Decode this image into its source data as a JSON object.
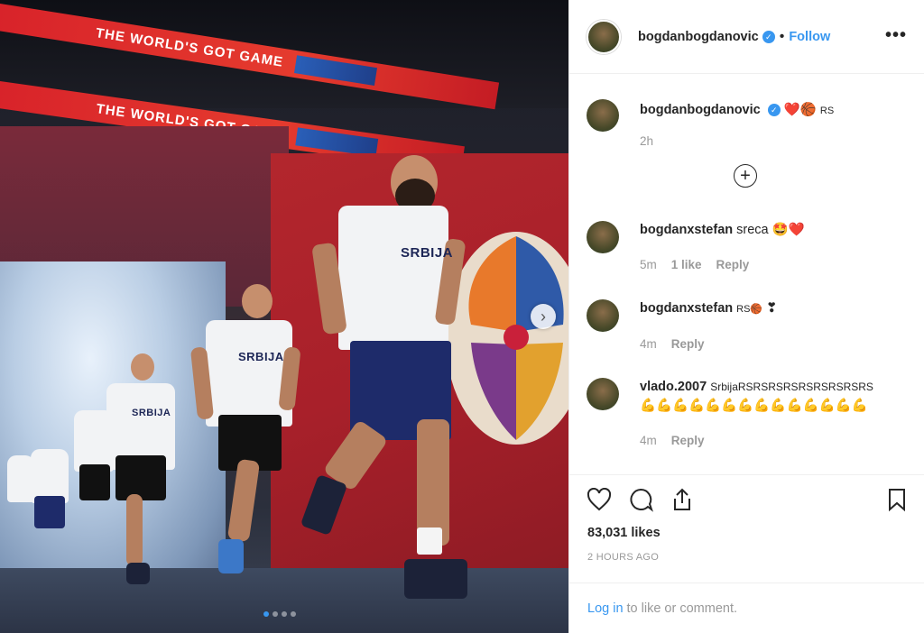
{
  "header": {
    "username": "bogdanbogdanovic",
    "separator": "•",
    "follow_label": "Follow",
    "more_label": "•••"
  },
  "photo": {
    "banner_text": "THE WORLD'S GOT GAME",
    "jersey_text": "SRBIJA",
    "active_slide": 1,
    "total_slides": 4
  },
  "caption": {
    "username": "bogdanbogdanovic",
    "emoji": "❤️🏀",
    "flag": "RS",
    "time": "2h"
  },
  "load_more_label": "+",
  "comments": [
    {
      "username": "bogdanxstefan",
      "text": "sreca",
      "emoji": "🤩❤️",
      "time": "5m",
      "likes": "1 like",
      "reply_label": "Reply"
    },
    {
      "username": "bogdanxstefan",
      "text": "RS🏀",
      "emoji": "❣",
      "time": "4m",
      "reply_label": "Reply"
    },
    {
      "username": "vlado.2007",
      "text": "SrbijaRSRSRSRSRSRSRSRSRS",
      "emoji": "💪💪💪💪💪💪💪💪💪💪💪💪💪💪",
      "time": "4m",
      "reply_label": "Reply"
    }
  ],
  "actions": {
    "likes": "83,031 likes",
    "posted": "2 HOURS AGO"
  },
  "login": {
    "link": "Log in",
    "text": "to like or comment."
  },
  "colors": {
    "accent": "#3897f0",
    "muted": "#999999",
    "text": "#262626",
    "banner_red": "#d8232a"
  }
}
